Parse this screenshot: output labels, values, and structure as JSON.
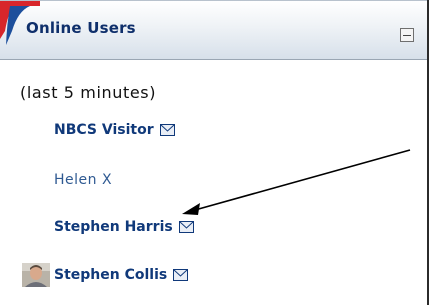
{
  "block": {
    "title": "Online Users",
    "subtitle": "(last 5 minutes)"
  },
  "users": [
    {
      "name": "NBCS Visitor",
      "has_message_icon": true
    },
    {
      "name": "Helen X",
      "has_message_icon": false
    },
    {
      "name": "Stephen Harris",
      "has_message_icon": true
    },
    {
      "name": "Stephen Collis",
      "has_message_icon": true,
      "has_avatar": true
    }
  ],
  "icons": {
    "message": "envelope-icon",
    "collapse": "minus-icon"
  },
  "colors": {
    "title": "#0f2f6b",
    "link": "#10397a",
    "logo_red": "#d8262b",
    "logo_blue": "#1d4f9c"
  }
}
